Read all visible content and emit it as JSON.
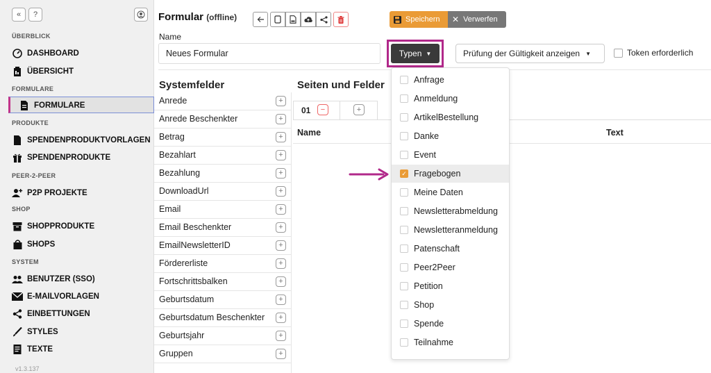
{
  "sidebar": {
    "sections": {
      "overview": "ÜBERBLICK",
      "forms": "FORMULARE",
      "products": "PRODUKTE",
      "p2p": "PEER-2-PEER",
      "shop": "SHOP",
      "system": "SYSTEM"
    },
    "items": {
      "dashboard": "DASHBOARD",
      "overview": "ÜBERSICHT",
      "forms": "FORMULARE",
      "donation_templates": "SPENDENPRODUKTVORLAGEN",
      "donation_products": "SPENDENPRODUKTE",
      "p2p_projects": "P2P PROJEKTE",
      "shop_products": "SHOPPRODUKTE",
      "shops": "SHOPS",
      "users": "BENUTZER (SSO)",
      "email_templates": "E-MAILVORLAGEN",
      "embeds": "EINBETTUNGEN",
      "styles": "STYLES",
      "texts": "TEXTE"
    },
    "version": "v1.3.137"
  },
  "header": {
    "title": "Formular",
    "subtitle": "(offline)",
    "save_label": "Speichern",
    "discard_label": "Verwerfen"
  },
  "form": {
    "name_label": "Name",
    "name_value": "Neues Formular",
    "types_label": "Typen",
    "validity_label": "Prüfung der Gültigkeit anzeigen",
    "token_label": "Token erforderlich"
  },
  "system_fields": {
    "title": "Systemfelder",
    "items": [
      "Anrede",
      "Anrede Beschenkter",
      "Betrag",
      "Bezahlart",
      "Bezahlung",
      "DownloadUrl",
      "Email",
      "Email Beschenkter",
      "EmailNewsletterID",
      "Fördererliste",
      "Fortschrittsbalken",
      "Geburtsdatum",
      "Geburtsdatum Beschenkter",
      "Geburtsjahr",
      "Gruppen"
    ]
  },
  "pages": {
    "title": "Seiten und Felder",
    "tab": "01",
    "col_name": "Name",
    "col_text": "Text"
  },
  "types_dropdown": {
    "options": [
      "Anfrage",
      "Anmeldung",
      "ArtikelBestellung",
      "Danke",
      "Event",
      "Fragebogen",
      "Meine Daten",
      "Newsletterabmeldung",
      "Newsletteranmeldung",
      "Patenschaft",
      "Peer2Peer",
      "Petition",
      "Shop",
      "Spende",
      "Teilnahme"
    ],
    "checked": "Fragebogen"
  },
  "colors": {
    "accent_orange": "#ea9b36",
    "highlight_magenta": "#b1288a"
  }
}
